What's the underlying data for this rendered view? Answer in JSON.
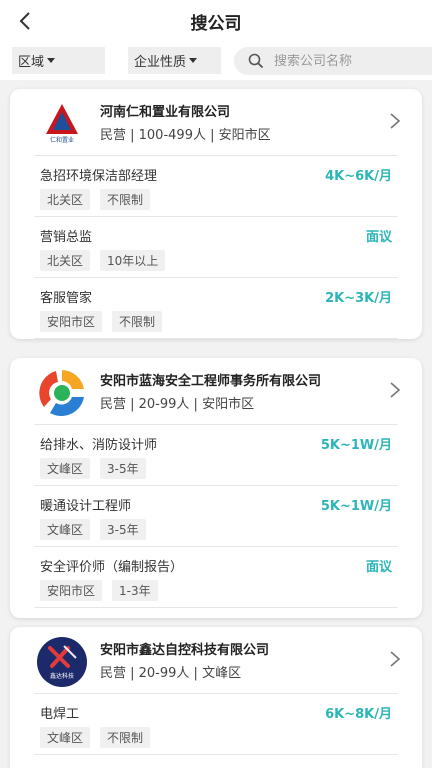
{
  "header": {
    "title": "搜公司"
  },
  "filters": {
    "region": "区域",
    "company_type": "企业性质",
    "search_placeholder": "搜索公司名称"
  },
  "colors": {
    "salary": "#2bb5b8",
    "background": "#f2f2f2"
  },
  "companies": [
    {
      "name": "河南仁和置业有限公司",
      "meta": "民营 | 100-499人 | 安阳市区",
      "logo_text": "仁和置业",
      "jobs": [
        {
          "title": "急招环境保洁部经理",
          "salary": "4K~6K/月",
          "tags": [
            "北关区",
            "不限制"
          ]
        },
        {
          "title": "营销总监",
          "salary": "面议",
          "tags": [
            "北关区",
            "10年以上"
          ]
        },
        {
          "title": "客服管家",
          "salary": "2K~3K/月",
          "tags": [
            "安阳市区",
            "不限制"
          ]
        }
      ]
    },
    {
      "name": "安阳市蓝海安全工程师事务所有限公司",
      "meta": "民营 | 20-99人 | 安阳市区",
      "jobs": [
        {
          "title": "给排水、消防设计师",
          "salary": "5K~1W/月",
          "tags": [
            "文峰区",
            "3-5年"
          ]
        },
        {
          "title": "暖通设计工程师",
          "salary": "5K~1W/月",
          "tags": [
            "文峰区",
            "3-5年"
          ]
        },
        {
          "title": "安全评价师（编制报告）",
          "salary": "面议",
          "tags": [
            "安阳市区",
            "1-3年"
          ]
        }
      ]
    },
    {
      "name": "安阳市鑫达自控科技有限公司",
      "meta": "民营 | 20-99人 | 文峰区",
      "logo_text": "鑫达科技",
      "jobs": [
        {
          "title": "电焊工",
          "salary": "6K~8K/月",
          "tags": [
            "文峰区",
            "不限制"
          ]
        }
      ]
    }
  ]
}
